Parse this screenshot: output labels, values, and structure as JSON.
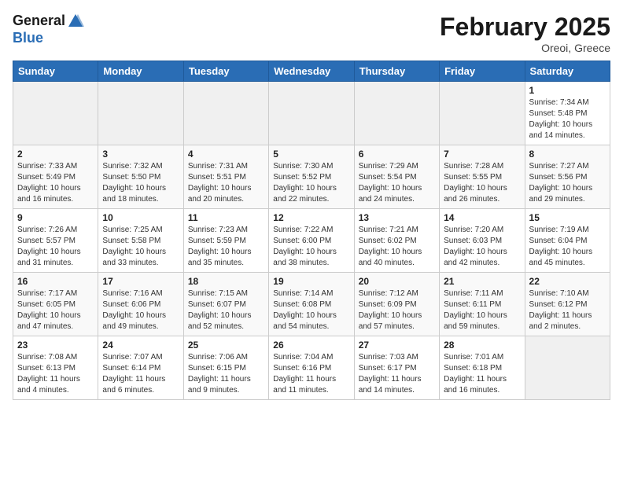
{
  "header": {
    "logo_line1": "General",
    "logo_line2": "Blue",
    "month_title": "February 2025",
    "location": "Oreoi, Greece"
  },
  "days_of_week": [
    "Sunday",
    "Monday",
    "Tuesday",
    "Wednesday",
    "Thursday",
    "Friday",
    "Saturday"
  ],
  "weeks": [
    [
      {
        "day": "",
        "info": ""
      },
      {
        "day": "",
        "info": ""
      },
      {
        "day": "",
        "info": ""
      },
      {
        "day": "",
        "info": ""
      },
      {
        "day": "",
        "info": ""
      },
      {
        "day": "",
        "info": ""
      },
      {
        "day": "1",
        "info": "Sunrise: 7:34 AM\nSunset: 5:48 PM\nDaylight: 10 hours and 14 minutes."
      }
    ],
    [
      {
        "day": "2",
        "info": "Sunrise: 7:33 AM\nSunset: 5:49 PM\nDaylight: 10 hours and 16 minutes."
      },
      {
        "day": "3",
        "info": "Sunrise: 7:32 AM\nSunset: 5:50 PM\nDaylight: 10 hours and 18 minutes."
      },
      {
        "day": "4",
        "info": "Sunrise: 7:31 AM\nSunset: 5:51 PM\nDaylight: 10 hours and 20 minutes."
      },
      {
        "day": "5",
        "info": "Sunrise: 7:30 AM\nSunset: 5:52 PM\nDaylight: 10 hours and 22 minutes."
      },
      {
        "day": "6",
        "info": "Sunrise: 7:29 AM\nSunset: 5:54 PM\nDaylight: 10 hours and 24 minutes."
      },
      {
        "day": "7",
        "info": "Sunrise: 7:28 AM\nSunset: 5:55 PM\nDaylight: 10 hours and 26 minutes."
      },
      {
        "day": "8",
        "info": "Sunrise: 7:27 AM\nSunset: 5:56 PM\nDaylight: 10 hours and 29 minutes."
      }
    ],
    [
      {
        "day": "9",
        "info": "Sunrise: 7:26 AM\nSunset: 5:57 PM\nDaylight: 10 hours and 31 minutes."
      },
      {
        "day": "10",
        "info": "Sunrise: 7:25 AM\nSunset: 5:58 PM\nDaylight: 10 hours and 33 minutes."
      },
      {
        "day": "11",
        "info": "Sunrise: 7:23 AM\nSunset: 5:59 PM\nDaylight: 10 hours and 35 minutes."
      },
      {
        "day": "12",
        "info": "Sunrise: 7:22 AM\nSunset: 6:00 PM\nDaylight: 10 hours and 38 minutes."
      },
      {
        "day": "13",
        "info": "Sunrise: 7:21 AM\nSunset: 6:02 PM\nDaylight: 10 hours and 40 minutes."
      },
      {
        "day": "14",
        "info": "Sunrise: 7:20 AM\nSunset: 6:03 PM\nDaylight: 10 hours and 42 minutes."
      },
      {
        "day": "15",
        "info": "Sunrise: 7:19 AM\nSunset: 6:04 PM\nDaylight: 10 hours and 45 minutes."
      }
    ],
    [
      {
        "day": "16",
        "info": "Sunrise: 7:17 AM\nSunset: 6:05 PM\nDaylight: 10 hours and 47 minutes."
      },
      {
        "day": "17",
        "info": "Sunrise: 7:16 AM\nSunset: 6:06 PM\nDaylight: 10 hours and 49 minutes."
      },
      {
        "day": "18",
        "info": "Sunrise: 7:15 AM\nSunset: 6:07 PM\nDaylight: 10 hours and 52 minutes."
      },
      {
        "day": "19",
        "info": "Sunrise: 7:14 AM\nSunset: 6:08 PM\nDaylight: 10 hours and 54 minutes."
      },
      {
        "day": "20",
        "info": "Sunrise: 7:12 AM\nSunset: 6:09 PM\nDaylight: 10 hours and 57 minutes."
      },
      {
        "day": "21",
        "info": "Sunrise: 7:11 AM\nSunset: 6:11 PM\nDaylight: 10 hours and 59 minutes."
      },
      {
        "day": "22",
        "info": "Sunrise: 7:10 AM\nSunset: 6:12 PM\nDaylight: 11 hours and 2 minutes."
      }
    ],
    [
      {
        "day": "23",
        "info": "Sunrise: 7:08 AM\nSunset: 6:13 PM\nDaylight: 11 hours and 4 minutes."
      },
      {
        "day": "24",
        "info": "Sunrise: 7:07 AM\nSunset: 6:14 PM\nDaylight: 11 hours and 6 minutes."
      },
      {
        "day": "25",
        "info": "Sunrise: 7:06 AM\nSunset: 6:15 PM\nDaylight: 11 hours and 9 minutes."
      },
      {
        "day": "26",
        "info": "Sunrise: 7:04 AM\nSunset: 6:16 PM\nDaylight: 11 hours and 11 minutes."
      },
      {
        "day": "27",
        "info": "Sunrise: 7:03 AM\nSunset: 6:17 PM\nDaylight: 11 hours and 14 minutes."
      },
      {
        "day": "28",
        "info": "Sunrise: 7:01 AM\nSunset: 6:18 PM\nDaylight: 11 hours and 16 minutes."
      },
      {
        "day": "",
        "info": ""
      }
    ]
  ]
}
